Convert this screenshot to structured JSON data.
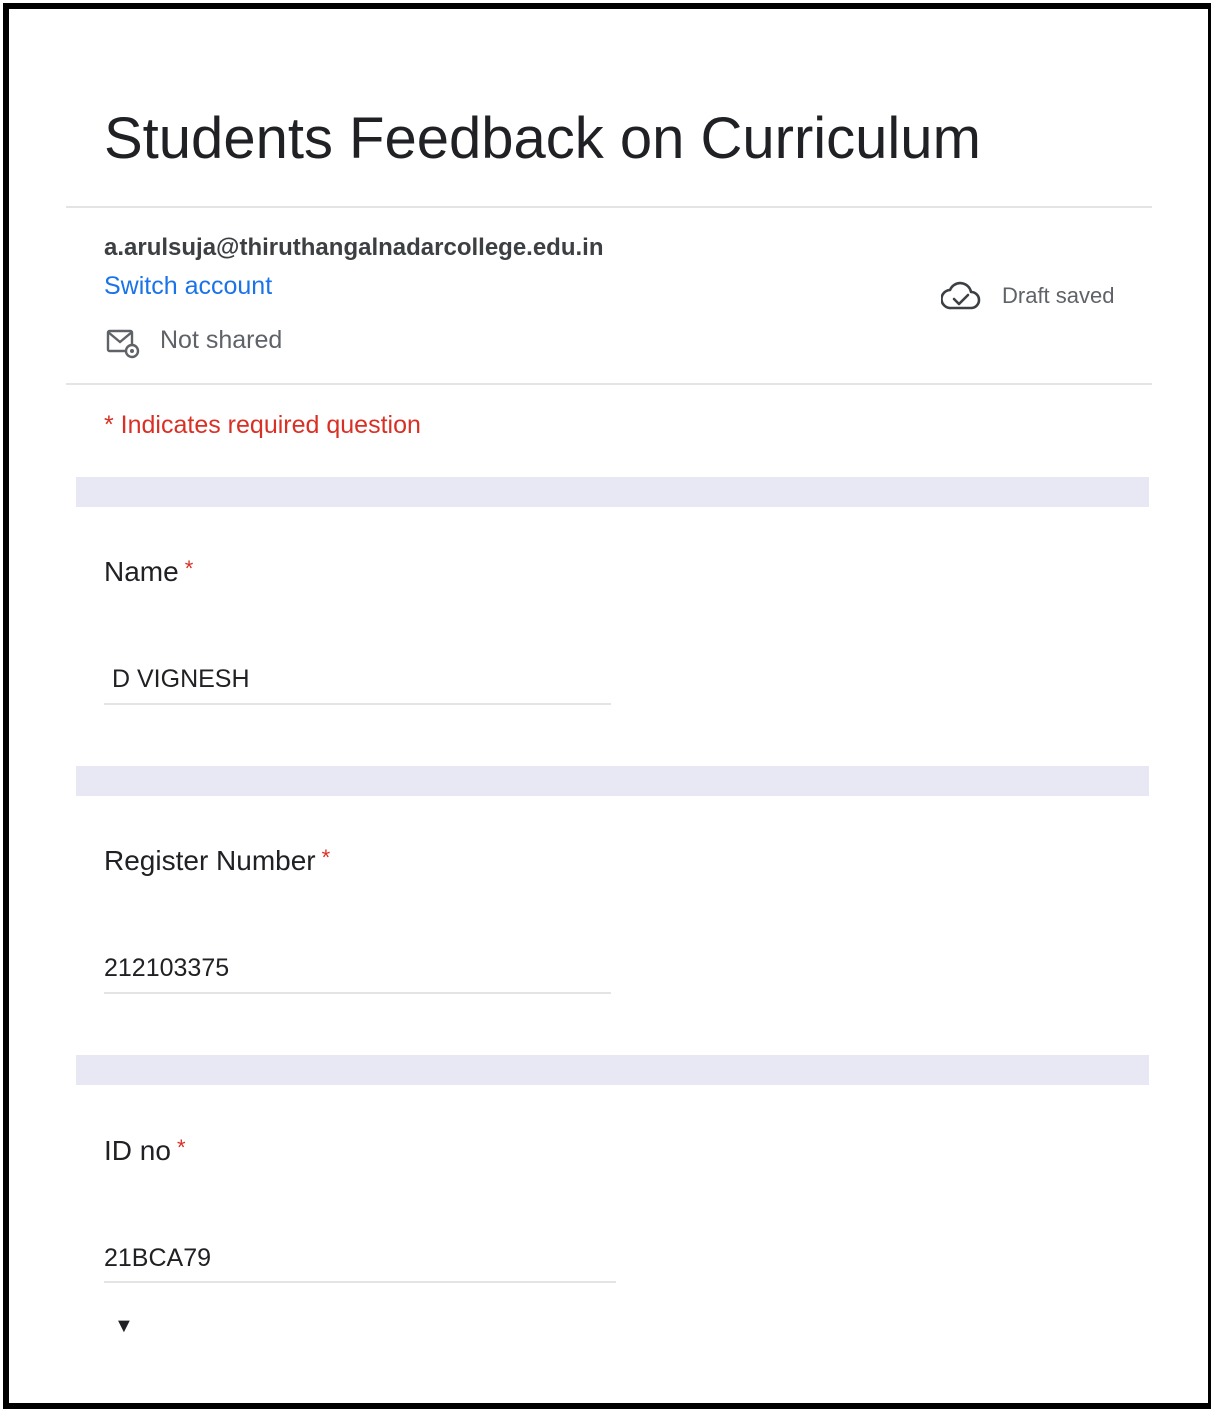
{
  "form": {
    "title": "Students Feedback on Curriculum"
  },
  "account": {
    "email": "a.arulsuja@thiruthangalnadarcollege.edu.in",
    "switch_label": "Switch account",
    "not_shared_label": "Not shared",
    "draft_status": "Draft saved"
  },
  "required_note": "* Indicates required question",
  "questions": [
    {
      "label": "Name",
      "required_mark": "*",
      "answer": "D VIGNESH"
    },
    {
      "label": "Register Number",
      "required_mark": "*",
      "answer": "212103375"
    },
    {
      "label": "ID no",
      "required_mark": "*",
      "answer": "21BCA79"
    }
  ],
  "icons": {
    "mail": "mail-settings-icon",
    "cloud": "cloud-done-icon",
    "arrow": "triangle-down-icon"
  },
  "colors": {
    "link": "#1a73e8",
    "required": "#d93025",
    "band": "#e8e8f4"
  }
}
